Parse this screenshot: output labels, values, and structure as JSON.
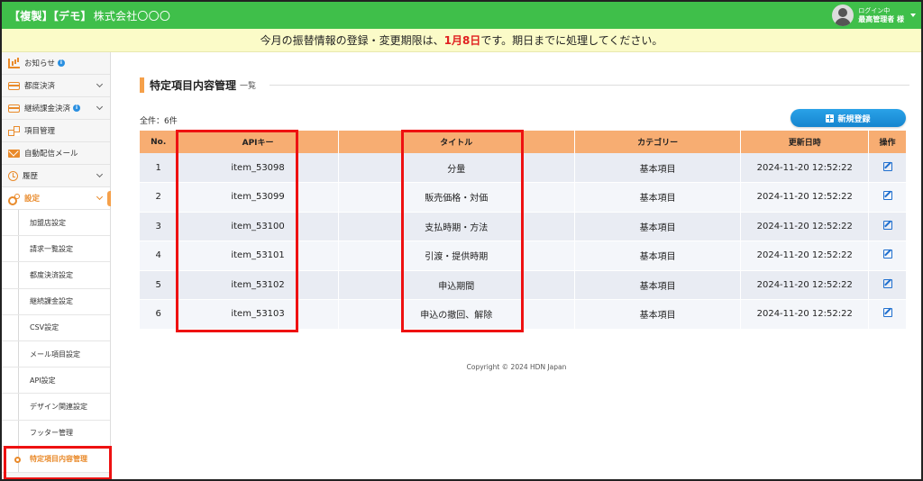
{
  "header": {
    "tag_copy": "【複製】",
    "tag_demo": "【デモ】",
    "company": "株式会社〇〇〇",
    "login_status": "ログイン中",
    "user_name": "最高管理者 様"
  },
  "notice": {
    "prefix": "今月の振替情報の登録・変更期限は、",
    "deadline": "1月8日",
    "suffix": "です。期日までに処理してください。"
  },
  "sidebar": {
    "items": [
      {
        "label": "お知らせ",
        "icon": "chart-icon",
        "info": "i"
      },
      {
        "label": "都度決済",
        "icon": "card-icon"
      },
      {
        "label": "継続課金決済",
        "icon": "card-icon",
        "info": "i"
      },
      {
        "label": "項目管理",
        "icon": "cubes-icon"
      },
      {
        "label": "自動配信メール",
        "icon": "mail-icon"
      },
      {
        "label": "履歴",
        "icon": "history-icon"
      },
      {
        "label": "設定",
        "icon": "gears-icon"
      }
    ],
    "sub_items": [
      "加盟店設定",
      "請求一覧設定",
      "都度決済設定",
      "継続課金設定",
      "CSV設定",
      "メール項目設定",
      "API設定",
      "デザイン関連設定",
      "フッター管理",
      "特定項目内容管理"
    ]
  },
  "main": {
    "title": "特定項目内容管理",
    "subtitle": "一覧",
    "count": "全件：6件",
    "new_button": "新規登録",
    "columns": [
      "No.",
      "APIキー",
      "タイトル",
      "カテゴリー",
      "更新日時",
      "操作"
    ],
    "rows": [
      {
        "no": "1",
        "api_key": "item_53098",
        "title": "分量",
        "category": "基本項目",
        "updated": "2024-11-20 12:52:22"
      },
      {
        "no": "2",
        "api_key": "item_53099",
        "title": "販売価格・対価",
        "category": "基本項目",
        "updated": "2024-11-20 12:52:22"
      },
      {
        "no": "3",
        "api_key": "item_53100",
        "title": "支払時期・方法",
        "category": "基本項目",
        "updated": "2024-11-20 12:52:22"
      },
      {
        "no": "4",
        "api_key": "item_53101",
        "title": "引渡・提供時期",
        "category": "基本項目",
        "updated": "2024-11-20 12:52:22"
      },
      {
        "no": "5",
        "api_key": "item_53102",
        "title": "申込期間",
        "category": "基本項目",
        "updated": "2024-11-20 12:52:22"
      },
      {
        "no": "6",
        "api_key": "item_53103",
        "title": "申込の撤回、解除",
        "category": "基本項目",
        "updated": "2024-11-20 12:52:22"
      }
    ],
    "copyright": "Copyright © 2024 HDN Japan"
  },
  "colors": {
    "header_green": "#3fbf4a",
    "notice_bg": "#fbfbc8",
    "accent_orange": "#f5a04a",
    "table_header": "#f7ad72",
    "button_blue": "#1890d8",
    "highlight_red": "#ee1111"
  }
}
